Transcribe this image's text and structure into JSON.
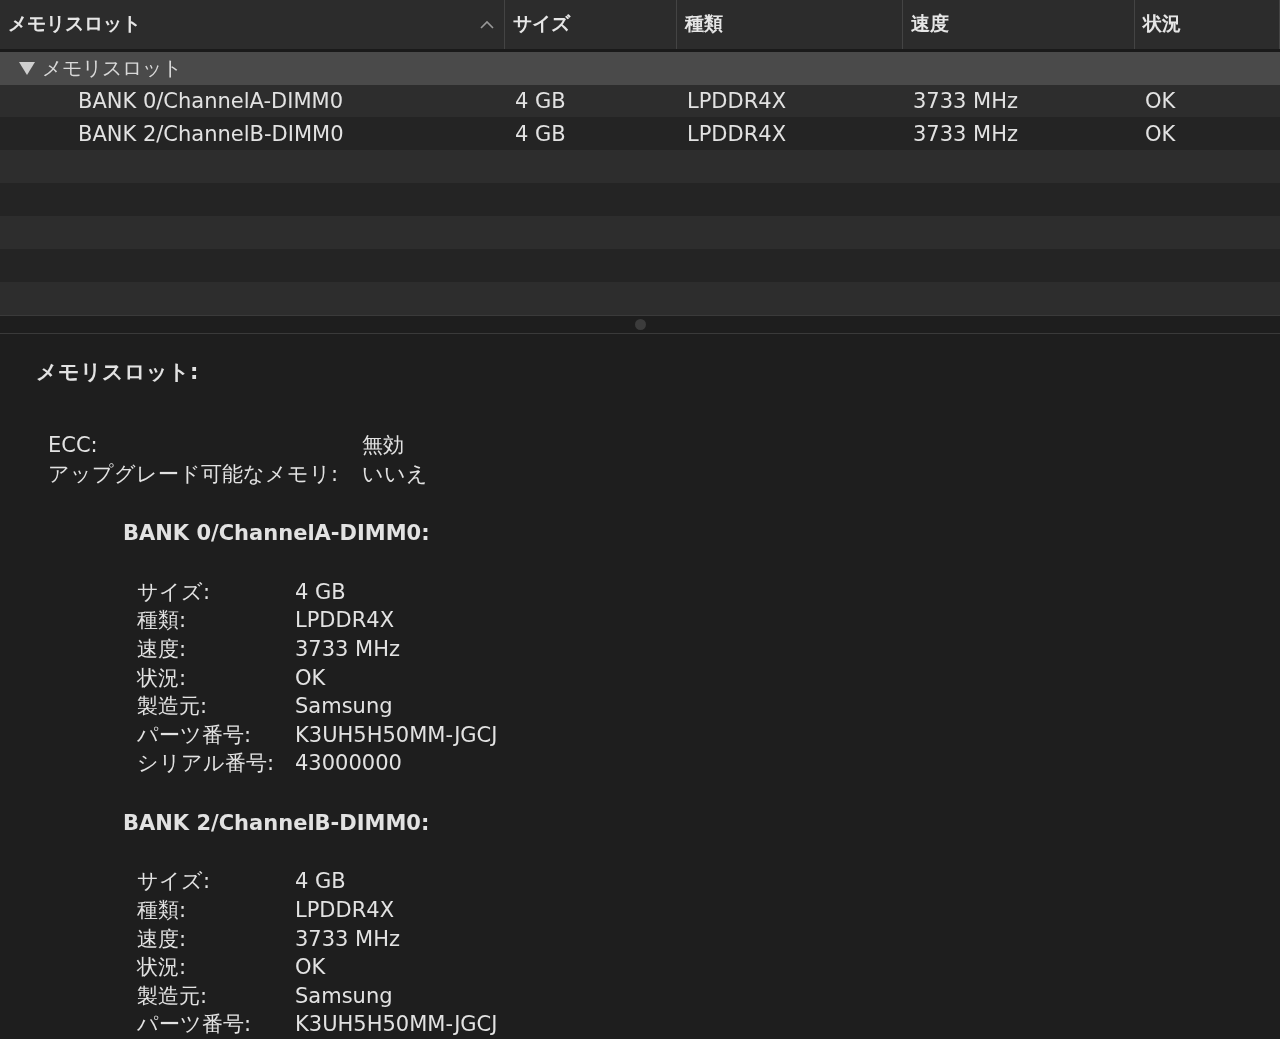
{
  "table": {
    "columns": [
      {
        "label": "メモリスロット",
        "sorted": true
      },
      {
        "label": "サイズ",
        "sorted": false
      },
      {
        "label": "種類",
        "sorted": false
      },
      {
        "label": "速度",
        "sorted": false
      },
      {
        "label": "状況",
        "sorted": false
      }
    ],
    "group": {
      "label": "メモリスロット",
      "expanded": true,
      "rows": [
        {
          "cells": [
            "BANK 0/ChannelA-DIMM0",
            "4 GB",
            "LPDDR4X",
            "3733 MHz",
            "OK"
          ]
        },
        {
          "cells": [
            "BANK 2/ChannelB-DIMM0",
            "4 GB",
            "LPDDR4X",
            "3733 MHz",
            "OK"
          ]
        }
      ]
    }
  },
  "detail": {
    "title": "メモリスロット:",
    "properties": [
      {
        "label": "ECC:",
        "value": "無効"
      },
      {
        "label": "アップグレード可能なメモリ:",
        "value": "いいえ"
      }
    ],
    "banks": [
      {
        "title": "BANK 0/ChannelA-DIMM0:",
        "properties": [
          {
            "label": "サイズ:",
            "value": "4 GB"
          },
          {
            "label": "種類:",
            "value": "LPDDR4X"
          },
          {
            "label": "速度:",
            "value": "3733 MHz"
          },
          {
            "label": "状況:",
            "value": "OK"
          },
          {
            "label": "製造元:",
            "value": "Samsung"
          },
          {
            "label": "パーツ番号:",
            "value": "K3UH5H50MM-JGCJ"
          },
          {
            "label": "シリアル番号:",
            "value": "43000000"
          }
        ]
      },
      {
        "title": "BANK 2/ChannelB-DIMM0:",
        "properties": [
          {
            "label": "サイズ:",
            "value": "4 GB"
          },
          {
            "label": "種類:",
            "value": "LPDDR4X"
          },
          {
            "label": "速度:",
            "value": "3733 MHz"
          },
          {
            "label": "状況:",
            "value": "OK"
          },
          {
            "label": "製造元:",
            "value": "Samsung"
          },
          {
            "label": "パーツ番号:",
            "value": "K3UH5H50MM-JGCJ"
          }
        ]
      }
    ]
  }
}
